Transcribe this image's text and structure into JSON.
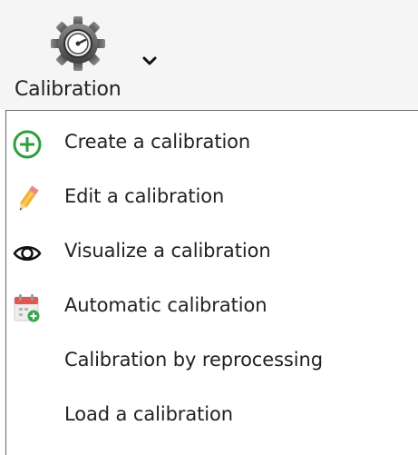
{
  "ribbon": {
    "button_label": "Calibration",
    "button_icon": "calibration-gear-icon",
    "dropdown_icon": "chevron-down-icon"
  },
  "menu": {
    "items": [
      {
        "label": "Create a calibration",
        "icon": "plus-circle-icon"
      },
      {
        "label": "Edit a calibration",
        "icon": "pencil-icon"
      },
      {
        "label": "Visualize a calibration",
        "icon": "eye-icon"
      },
      {
        "label": "Automatic calibration",
        "icon": "calendar-add-icon"
      },
      {
        "label": "Calibration by reprocessing",
        "icon": ""
      },
      {
        "label": "Load a calibration",
        "icon": ""
      }
    ]
  },
  "colors": {
    "ribbon_bg": "#f5f5f5",
    "menu_border": "#646464",
    "create_icon": "#2e9e3c",
    "gear": "#5a5a5a",
    "calendar_red": "#e0574f"
  }
}
